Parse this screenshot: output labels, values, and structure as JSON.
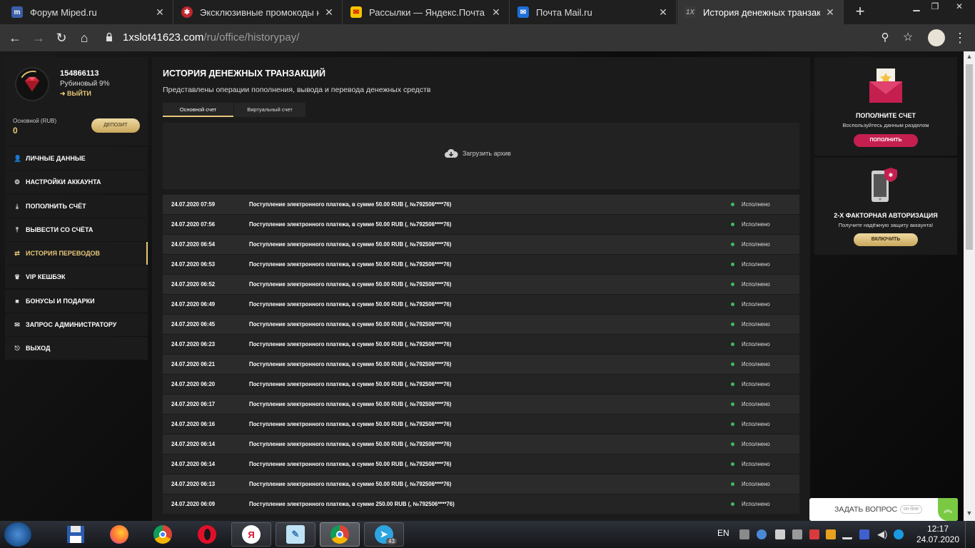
{
  "browser": {
    "tabs": [
      {
        "title": "Форум Miped.ru",
        "active": false
      },
      {
        "title": "Эксклюзивные промокоды на",
        "active": false
      },
      {
        "title": "Рассылки — Яндекс.Почта",
        "active": false
      },
      {
        "title": "Почта Mail.ru",
        "active": false
      },
      {
        "title": "История денежных транзакций",
        "active": true
      }
    ],
    "new_tab": "+",
    "url_domain": "1xslot41623.com",
    "url_path": "/ru/office/historypay/"
  },
  "profile": {
    "user_id": "154866113",
    "rank": "Рубиновый 9%",
    "logout": "ВЫЙТИ",
    "balance_label": "Основной (RUB)",
    "balance_value": "0",
    "deposit_button": "ДЕПОЗИТ"
  },
  "menu": [
    {
      "label": "ЛИЧНЫЕ ДАННЫЕ",
      "icon": "user-icon",
      "active": false
    },
    {
      "label": "НАСТРОЙКИ АККАУНТА",
      "icon": "gears-icon",
      "active": false
    },
    {
      "label": "ПОПОЛНИТЬ СЧЁТ",
      "icon": "download-icon",
      "active": false
    },
    {
      "label": "ВЫВЕСТИ СО СЧЁТА",
      "icon": "upload-icon",
      "active": false
    },
    {
      "label": "ИСТОРИЯ ПЕРЕВОДОВ",
      "icon": "exchange-icon",
      "active": true
    },
    {
      "label": "VIP КЕШБЭК",
      "icon": "crown-icon",
      "active": false
    },
    {
      "label": "БОНУСЫ И ПОДАРКИ",
      "icon": "gift-icon",
      "active": false
    },
    {
      "label": "ЗАПРОС АДМИНИСТРАТОРУ",
      "icon": "envelope-icon",
      "active": false
    },
    {
      "label": "ВЫХОД",
      "icon": "exit-icon",
      "active": false
    }
  ],
  "main": {
    "title": "ИСТОРИЯ ДЕНЕЖНЫХ ТРАНЗАКЦИЙ",
    "subtitle": "Представлены операции пополнения, вывода и перевода денежных средств",
    "tabs": [
      "Основной счет",
      "Виртуальный счет"
    ],
    "archive_label": "Загрузить архив",
    "rows": [
      {
        "date": "24.07.2020 07:59",
        "text": "Поступление электронного платежа, в сумме 50.00 RUB (, №792506****76)",
        "status": "Исполнено"
      },
      {
        "date": "24.07.2020 07:56",
        "text": "Поступление электронного платежа, в сумме 50.00 RUB (, №792506****76)",
        "status": "Исполнено"
      },
      {
        "date": "24.07.2020 06:54",
        "text": "Поступление электронного платежа, в сумме 50.00 RUB (, №792506****76)",
        "status": "Исполнено"
      },
      {
        "date": "24.07.2020 06:53",
        "text": "Поступление электронного платежа, в сумме 50.00 RUB (, №792506****76)",
        "status": "Исполнено"
      },
      {
        "date": "24.07.2020 06:52",
        "text": "Поступление электронного платежа, в сумме 50.00 RUB (, №792506****76)",
        "status": "Исполнено"
      },
      {
        "date": "24.07.2020 06:49",
        "text": "Поступление электронного платежа, в сумме 50.00 RUB (, №792506****76)",
        "status": "Исполнено"
      },
      {
        "date": "24.07.2020 06:45",
        "text": "Поступление электронного платежа, в сумме 50.00 RUB (, №792506****76)",
        "status": "Исполнено"
      },
      {
        "date": "24.07.2020 06:23",
        "text": "Поступление электронного платежа, в сумме 50.00 RUB (, №792506****76)",
        "status": "Исполнено"
      },
      {
        "date": "24.07.2020 06:21",
        "text": "Поступление электронного платежа, в сумме 50.00 RUB (, №792506****76)",
        "status": "Исполнено"
      },
      {
        "date": "24.07.2020 06:20",
        "text": "Поступление электронного платежа, в сумме 50.00 RUB (, №792506****76)",
        "status": "Исполнено"
      },
      {
        "date": "24.07.2020 06:17",
        "text": "Поступление электронного платежа, в сумме 50.00 RUB (, №792506****76)",
        "status": "Исполнено"
      },
      {
        "date": "24.07.2020 06:16",
        "text": "Поступление электронного платежа, в сумме 50.00 RUB (, №792506****76)",
        "status": "Исполнено"
      },
      {
        "date": "24.07.2020 06:14",
        "text": "Поступление электронного платежа, в сумме 50.00 RUB (, №792506****76)",
        "status": "Исполнено"
      },
      {
        "date": "24.07.2020 06:14",
        "text": "Поступление электронного платежа, в сумме 50.00 RUB (, №792506****76)",
        "status": "Исполнено"
      },
      {
        "date": "24.07.2020 06:13",
        "text": "Поступление электронного платежа, в сумме 50.00 RUB (, №792506****76)",
        "status": "Исполнено"
      },
      {
        "date": "24.07.2020 06:09",
        "text": "Поступление электронного платежа, в сумме 250.00 RUB (, №792506****76)",
        "status": "Исполнено"
      }
    ]
  },
  "widgets": {
    "topup": {
      "title": "ПОПОЛНИТЕ СЧЕТ",
      "subtitle": "Воспользуйтесь данным разделом",
      "button": "ПОПОЛНИТЬ"
    },
    "twofa": {
      "title": "2-Х ФАКТОРНАЯ АВТОРИЗАЦИЯ",
      "subtitle": "Получите надёжную защиту аккаунта!",
      "button": "ВКЛЮЧИТЬ"
    }
  },
  "chat": {
    "label": "ЗАДАТЬ ВОПРОС",
    "status": "on-line"
  },
  "taskbar": {
    "language": "EN",
    "time": "12:17",
    "date": "24.07.2020",
    "telegram_badge": "43"
  },
  "colors": {
    "accent_gold": "#e8c779",
    "status_green": "#3dbb5c",
    "button_pink": "#c41f4f"
  }
}
